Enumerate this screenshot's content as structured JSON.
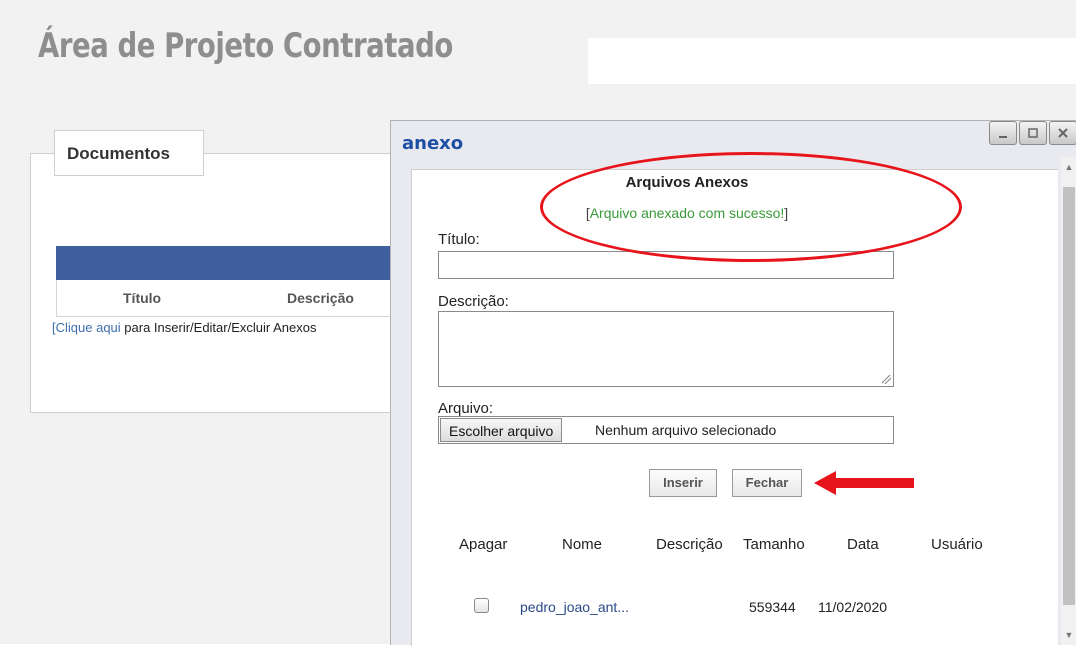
{
  "page": {
    "title": "Área de Projeto Contratado"
  },
  "documentos": {
    "legend": "Documentos",
    "columns": [
      "Título",
      "Descrição"
    ],
    "link_bracket_open": "[",
    "link_text": "Clique aqui",
    "link_suffix": " para Inserir/Editar/Excluir Anexos"
  },
  "modal": {
    "title": "anexo",
    "window_buttons": [
      "minimize",
      "maximize",
      "close"
    ],
    "heading": "Arquivos Anexos",
    "success_open": "[",
    "success_text": "Arquivo anexado com sucesso!",
    "success_close": "]",
    "titulo_label": "Título:",
    "titulo_value": "",
    "descricao_label": "Descrição:",
    "descricao_value": "",
    "arquivo_label": "Arquivo:",
    "choose_button": "Escolher arquivo",
    "no_file": "Nenhum arquivo selecionado",
    "insert_button": "Inserir",
    "close_button": "Fechar",
    "table": {
      "headers": [
        "Apagar",
        "Nome",
        "Descrição",
        "Tamanho",
        "Data",
        "Usuário"
      ],
      "rows": [
        {
          "checked": false,
          "nome": "pedro_joao_ant...",
          "descricao": "",
          "tamanho": "559344",
          "data": "11/02/2020",
          "usuario": ""
        }
      ]
    }
  },
  "colors": {
    "header_blue": "#3f5f9f",
    "modal_title": "#1e4fa3",
    "success_green": "#3a9a3a",
    "annotation_red": "#e8141b"
  },
  "icons": {
    "minimize": "minimize-icon",
    "maximize": "maximize-icon",
    "close": "close-icon",
    "arrow": "arrow-left-icon",
    "scroll_up": "scroll-up-icon",
    "scroll_down": "scroll-down-icon"
  }
}
